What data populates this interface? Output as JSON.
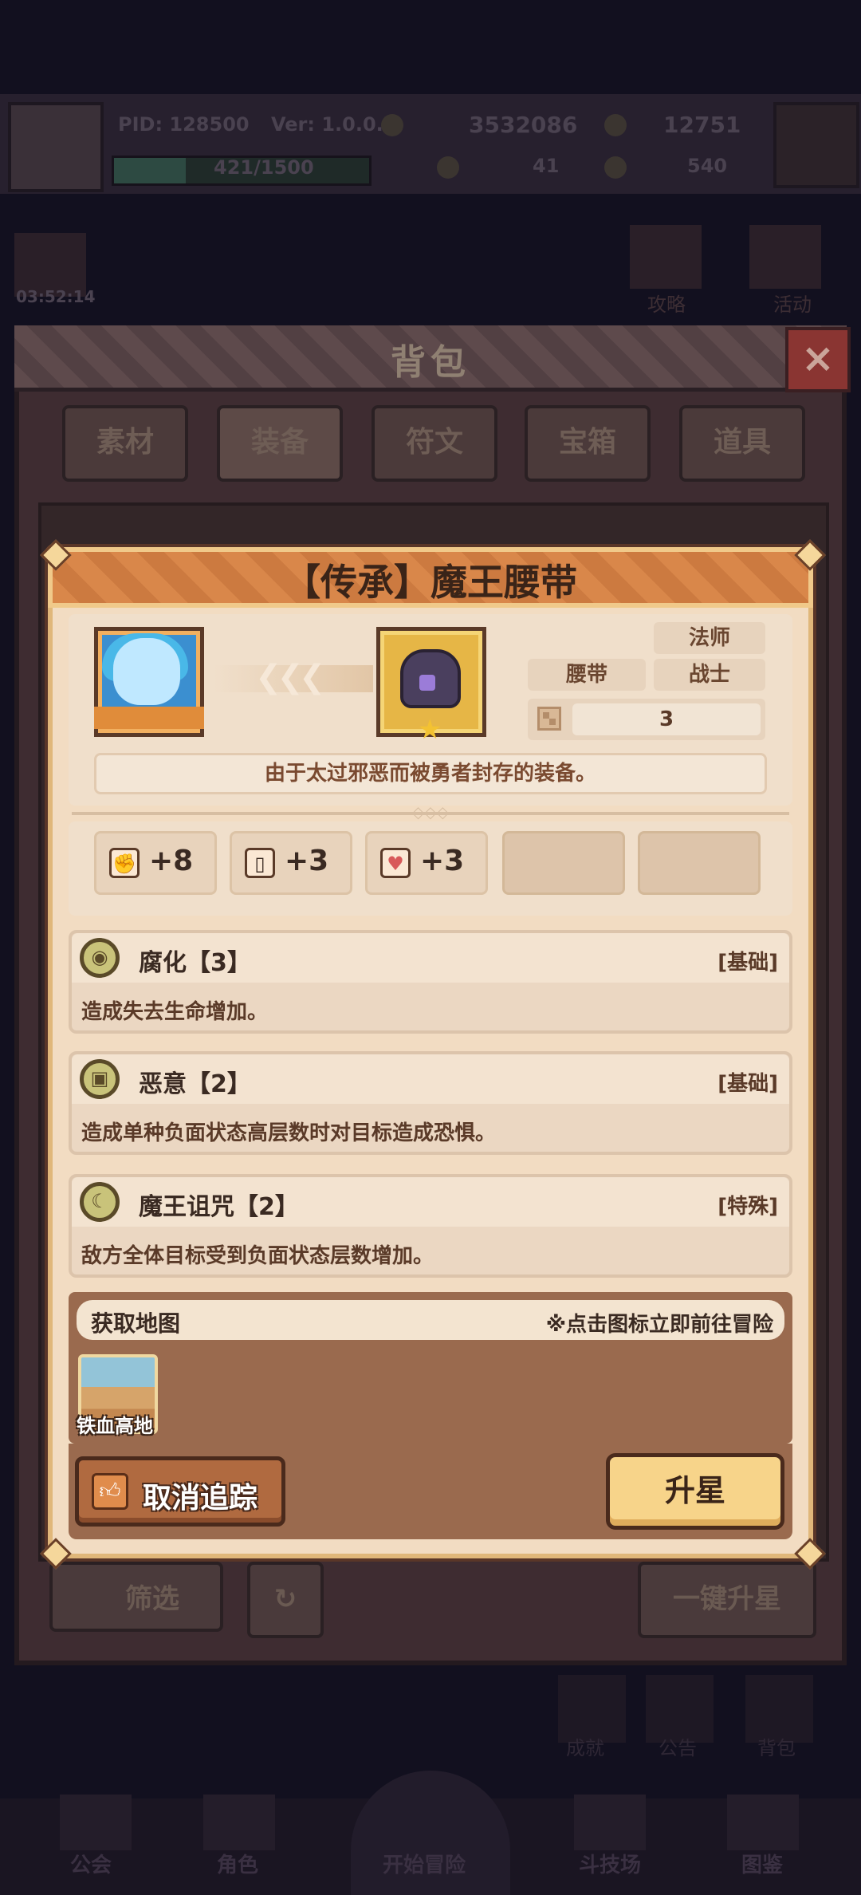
{
  "hud": {
    "pid": "PID: 128500",
    "version": "Ver: 1.0.0.7",
    "gold": "3532086",
    "gems": "12751",
    "exp": "421/1500",
    "exp_progress": 0.28,
    "clover": "41",
    "tickets": "540",
    "timer": "03:52:14",
    "side_buttons": [
      "攻略",
      "活动"
    ]
  },
  "backpack": {
    "title": "背包",
    "tabs": [
      "素材",
      "装备",
      "符文",
      "宝箱",
      "道具"
    ],
    "active_tab": "装备",
    "filter_label": "筛选",
    "star_all_label": "一键升星"
  },
  "bottom_nav": {
    "items": [
      "公会",
      "角色",
      "开始冒险",
      "斗技场",
      "图鉴"
    ],
    "shortcuts": [
      "成就",
      "公告",
      "背包"
    ]
  },
  "item": {
    "title": "【传承】魔王腰带",
    "tag_class_1": "法师",
    "tag_slot": "腰带",
    "tag_class_2": "战士",
    "signature_value": "3",
    "description": "由于太过邪恶而被勇者封存的装备。",
    "star_count": 1
  },
  "stats": [
    {
      "icon": "fist-icon",
      "value": "+8"
    },
    {
      "icon": "book-icon",
      "value": "+3"
    },
    {
      "icon": "heart-icon",
      "value": "+3"
    }
  ],
  "skills": [
    {
      "name": "腐化【3】",
      "type": "[基础]",
      "desc": "造成失去生命增加。"
    },
    {
      "name": "恶意【2】",
      "type": "[基础]",
      "desc": "造成单种负面状态高层数时对目标造成恐惧。"
    },
    {
      "name": "魔王诅咒【2】",
      "type": "[特殊]",
      "desc": "敌方全体目标受到负面状态层数增加。"
    }
  ],
  "map_section": {
    "title": "获取地图",
    "hint": "※点击图标立即前往冒险",
    "map_name": "铁血高地"
  },
  "buttons": {
    "untrack": "取消追踪",
    "upgrade_star": "升星"
  },
  "colors": {
    "header_orange": "#d9874a",
    "panel_cream": "#f2dcc2",
    "button_gold": "#f7d48a",
    "button_brown": "#b06a40"
  }
}
